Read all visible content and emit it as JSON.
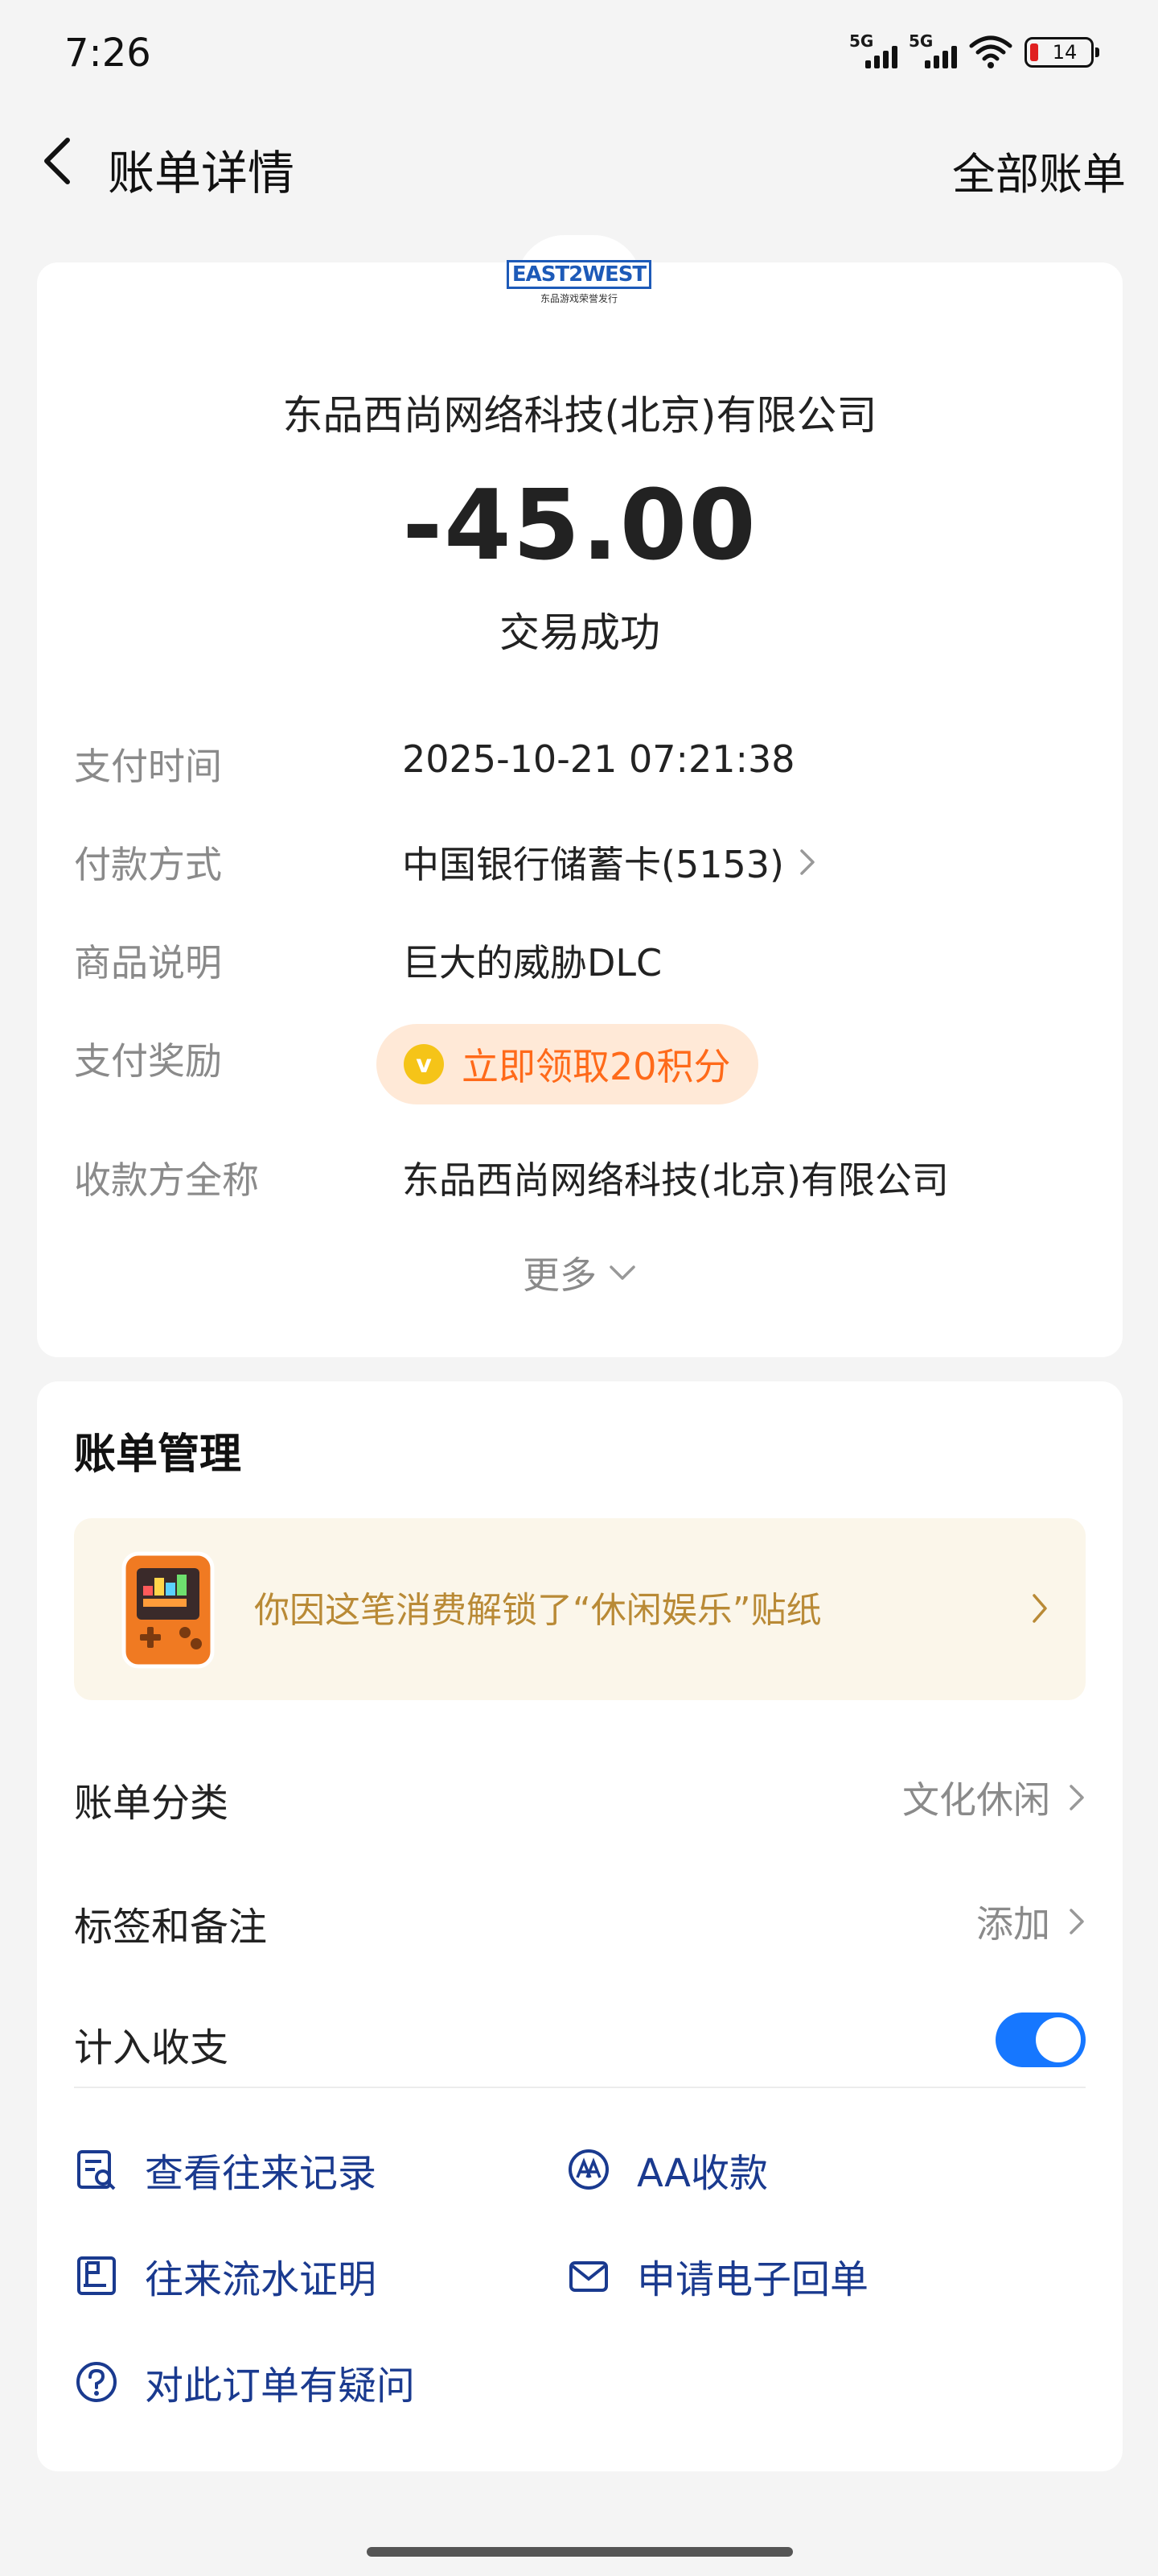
{
  "status_bar": {
    "time": "7:26",
    "network1": "5G",
    "network2": "5G",
    "battery": "14"
  },
  "nav": {
    "title": "账单详情",
    "right_link": "全部账单"
  },
  "bill": {
    "merchant_logo_text": "EAST2WEST",
    "merchant_logo_sub": "东品游戏荣誉发行",
    "merchant_name": "东品西尚网络科技(北京)有限公司",
    "amount": "-45.00",
    "status": "交易成功",
    "details": [
      {
        "label": "支付时间",
        "value": "2025-10-21 07:21:38"
      },
      {
        "label": "付款方式",
        "value": "中国银行储蓄卡(5153)"
      },
      {
        "label": "商品说明",
        "value": "巨大的威胁DLC"
      },
      {
        "label": "支付奖励",
        "value": "立即领取20积分"
      },
      {
        "label": "收款方全称",
        "value": "东品西尚网络科技(北京)有限公司"
      }
    ],
    "more_label": "更多"
  },
  "management": {
    "title": "账单管理",
    "sticker_text": "你因这笔消费解锁了“休闲娱乐”贴纸",
    "category_label": "账单分类",
    "category_value": "文化休闲",
    "tags_label": "标签和备注",
    "tags_value": "添加",
    "income_label": "计入收支",
    "income_enabled": true,
    "actions": {
      "history": "查看往来记录",
      "aa": "AA收款",
      "statement": "往来流水证明",
      "receipt": "申请电子回单",
      "question": "对此订单有疑问"
    }
  },
  "colors": {
    "accent": "#1677ff",
    "reward": "#ff6a1a",
    "action_text": "#1a3a8f"
  }
}
